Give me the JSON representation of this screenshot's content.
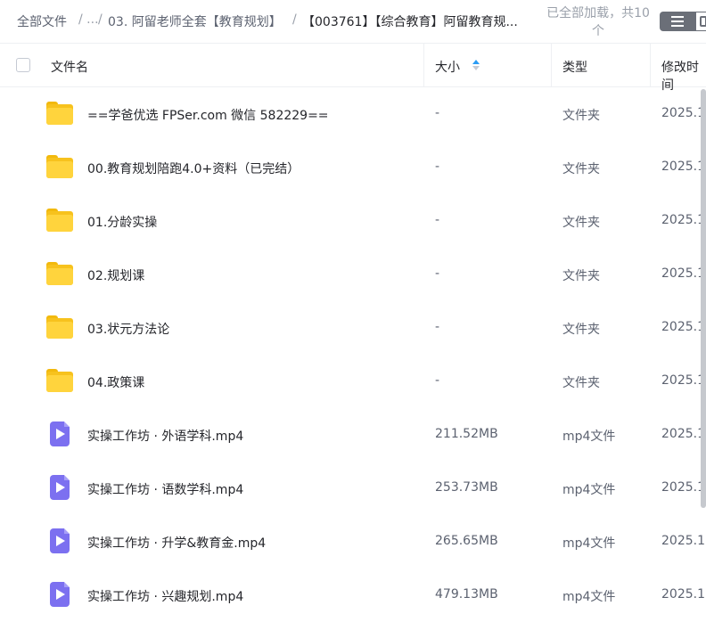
{
  "breadcrumb": {
    "root": "全部文件",
    "ellipsis": "/ ...",
    "sep1": "/",
    "parent": "03. 阿留老师全套【教育规划】",
    "sep2": "/",
    "current": "【003761】【综合教育】阿留教育规..."
  },
  "status": {
    "loaded_text": "已全部加载，共10个"
  },
  "table": {
    "columns": {
      "name": "文件名",
      "size": "大小",
      "type": "类型",
      "modified": "修改时间"
    },
    "rows": [
      {
        "icon": "folder-icon",
        "name": "==学爸优选 FPSer.com 微信 582229==",
        "size": "-",
        "type": "文件夹",
        "date": "2025.1"
      },
      {
        "icon": "folder-icon",
        "name": "00.教育规划陪跑4.0+资料（已完结）",
        "size": "-",
        "type": "文件夹",
        "date": "2025.1"
      },
      {
        "icon": "folder-icon",
        "name": "01.分龄实操",
        "size": "-",
        "type": "文件夹",
        "date": "2025.1"
      },
      {
        "icon": "folder-icon",
        "name": "02.规划课",
        "size": "-",
        "type": "文件夹",
        "date": "2025.1"
      },
      {
        "icon": "folder-icon",
        "name": "03.状元方法论",
        "size": "-",
        "type": "文件夹",
        "date": "2025.1"
      },
      {
        "icon": "folder-icon",
        "name": "04.政策课",
        "size": "-",
        "type": "文件夹",
        "date": "2025.1"
      },
      {
        "icon": "video-file-icon",
        "name": "实操工作坊 · 外语学科.mp4",
        "size": "211.52MB",
        "type": "mp4文件",
        "date": "2025.1"
      },
      {
        "icon": "video-file-icon",
        "name": "实操工作坊 · 语数学科.mp4",
        "size": "253.73MB",
        "type": "mp4文件",
        "date": "2025.1"
      },
      {
        "icon": "video-file-icon",
        "name": "实操工作坊 · 升学&教育金.mp4",
        "size": "265.65MB",
        "type": "mp4文件",
        "date": "2025.1"
      },
      {
        "icon": "video-file-icon",
        "name": "实操工作坊 · 兴趣规划.mp4",
        "size": "479.13MB",
        "type": "mp4文件",
        "date": "2025.1"
      }
    ]
  },
  "colors": {
    "folder": "#f7c21d",
    "video": "#7c70f0",
    "sort_active": "#2a9cf4",
    "toggle": "#6b6f78"
  }
}
